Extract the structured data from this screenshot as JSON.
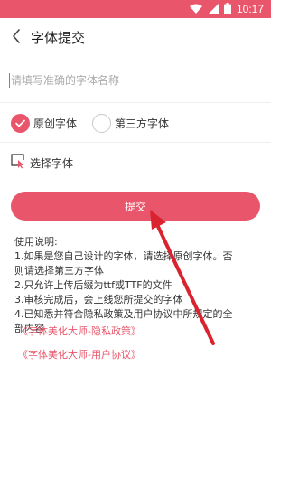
{
  "status_bar": {
    "time": "10:17",
    "icons": [
      "wifi-icon",
      "signal-icon",
      "battery-icon"
    ]
  },
  "header": {
    "title": "字体提交",
    "back_icon": "chevron-left-icon"
  },
  "font_name_input": {
    "placeholder": "请填写准确的字体名称",
    "value": ""
  },
  "font_type": {
    "options": [
      {
        "label": "原创字体",
        "selected": true
      },
      {
        "label": "第三方字体",
        "selected": false
      }
    ]
  },
  "choose_font": {
    "label": "选择字体",
    "icon": "select-file-icon"
  },
  "submit_label": "提交",
  "instructions": {
    "heading": "使用说明:",
    "lines": [
      "1.如果是您自己设计的字体，请选择原创字体。否",
      "则请选择第三方字体",
      "2.只允许上传后缀为ttf或TTF的文件",
      "3.审核完成后，会上线您所提交的字体",
      "4.已知悉并符合隐私政策及用户协议中所规定的全",
      "部内容"
    ]
  },
  "links": [
    "《字体美化大师-隐私政策》",
    "《字体美化大师-用户协议》"
  ],
  "colors": {
    "accent": "#e9566b",
    "annotation_arrow": "#d9232f"
  }
}
